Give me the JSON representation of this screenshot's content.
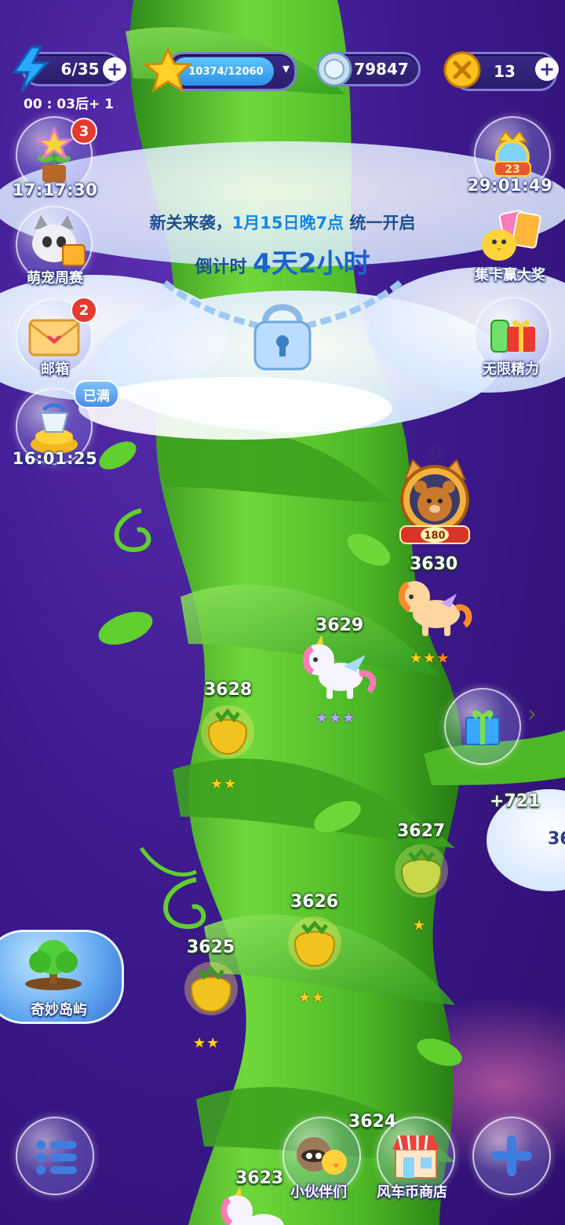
{
  "top_bar": {
    "energy": {
      "value": "6/35",
      "icon": "lightning-icon",
      "refill_timer": "00 : 03后+ 1"
    },
    "stars": {
      "value": "10374/12060",
      "icon": "star-icon",
      "progress": 0.86
    },
    "coins": {
      "value": "79847",
      "icon": "silver-coin-icon"
    },
    "tokens": {
      "value": "13",
      "icon": "gold-token-icon"
    },
    "plus_symbol": "+",
    "dropdown_symbol": "▾"
  },
  "left_side": [
    {
      "id": "flower",
      "label": "17:17:30",
      "badge": "3",
      "icon": "flower-pot-icon"
    },
    {
      "id": "pet",
      "label": "萌宠周赛",
      "icon": "cat-icon"
    },
    {
      "id": "mail",
      "label": "邮箱",
      "badge": "2",
      "icon": "envelope-icon"
    },
    {
      "id": "treasure",
      "label": "16:01:25",
      "tag": "已满",
      "icon": "coin-pile-icon"
    }
  ],
  "right_side": [
    {
      "id": "rank",
      "label": "29:01:49",
      "level": "23",
      "icon": "crown-badge-icon"
    },
    {
      "id": "cards",
      "label": "集卡赢大奖",
      "icon": "card-chick-icon"
    },
    {
      "id": "energy",
      "label": "无限精力",
      "icon": "gift-drink-icon"
    }
  ],
  "notice": {
    "line1_prefix": "新关来袭，",
    "line1_highlight": "1月15日晚7点",
    "line1_suffix": " 统一开启",
    "line2_prefix": "倒计时 ",
    "line2_value": "4天2小时"
  },
  "player": {
    "marker": "我",
    "level": "180",
    "icon": "bear-avatar-icon"
  },
  "levels": [
    {
      "num": "3630",
      "stars": 3,
      "style": "mixed"
    },
    {
      "num": "3629",
      "stars": 3,
      "style": "rainbow"
    },
    {
      "num": "3628",
      "stars": 2,
      "style": "gold"
    },
    {
      "num": "3627",
      "stars": 1,
      "style": "gold"
    },
    {
      "num": "3626",
      "stars": 2,
      "style": "gold"
    },
    {
      "num": "3625",
      "stars": 2,
      "style": "gold"
    },
    {
      "num": "3624",
      "stars": 0,
      "style": "gold"
    },
    {
      "num": "3623",
      "stars": 0,
      "style": "gold"
    }
  ],
  "gift_bonus": "+721",
  "edge_partial_text": "36",
  "island_button": {
    "label": "奇妙岛屿",
    "icon": "tree-island-icon"
  },
  "bottom_nav": {
    "menu": {
      "icon": "list-menu-icon"
    },
    "friends": {
      "label": "小伙伴们",
      "icon": "raccoon-chick-icon"
    },
    "shop": {
      "label": "风车币商店",
      "icon": "shop-icon"
    },
    "add": {
      "icon": "plus-icon"
    }
  },
  "colors": {
    "background": "#3d1a8e",
    "stalk_green": "#4fbf2a",
    "notice_blue": "#1e4f8f",
    "highlight_blue": "#1687e6"
  }
}
